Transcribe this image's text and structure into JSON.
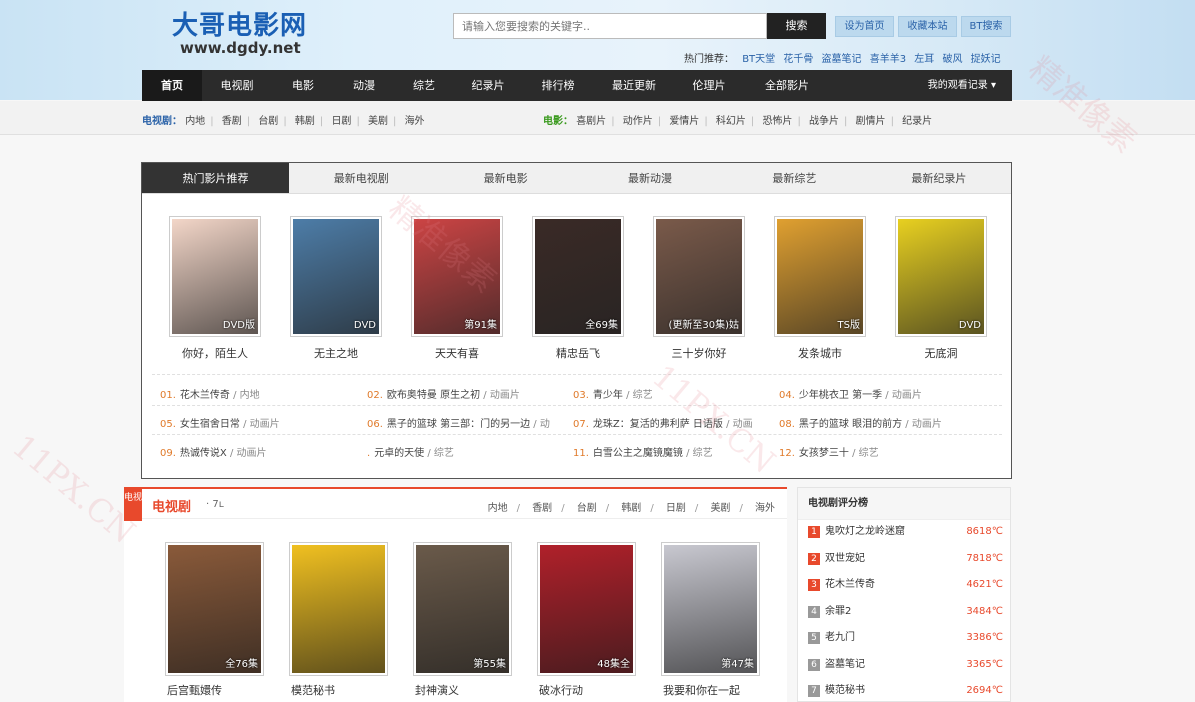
{
  "header": {
    "logo_cn": "大哥电影网",
    "logo_en": "www.dgdy.net",
    "search_placeholder": "请输入您要搜索的关键字..",
    "search_btn": "搜索",
    "top_links": [
      "设为首页",
      "收藏本站",
      "BT搜索"
    ],
    "hot_label": "热门推荐：",
    "hot_items": [
      "BT天堂",
      "花千骨",
      "盗墓笔记",
      "喜羊羊3",
      "左耳",
      "破风",
      "捉妖记"
    ]
  },
  "nav": {
    "items": [
      "首页",
      "电视剧",
      "电影",
      "动漫",
      "综艺",
      "纪录片",
      "排行榜",
      "最近更新",
      "伦理片",
      "全部影片"
    ],
    "record": "我的观看记录 ▾"
  },
  "subnav": {
    "tv_label": "电视剧：",
    "tv_items": [
      "内地",
      "香剧",
      "台剧",
      "韩剧",
      "日剧",
      "美剧",
      "海外"
    ],
    "movie_label": "电影：",
    "movie_items": [
      "喜剧片",
      "动作片",
      "爱情片",
      "科幻片",
      "恐怖片",
      "战争片",
      "剧情片",
      "纪录片"
    ]
  },
  "hot": {
    "tabs": [
      "热门影片推荐",
      "最新电视剧",
      "最新电影",
      "最新动漫",
      "最新综艺",
      "最新纪录片"
    ],
    "movies": [
      {
        "name": "你好，陌生人",
        "badge": "DVD版",
        "color": "#f3d6c8"
      },
      {
        "name": "无主之地",
        "badge": "DVD",
        "color": "#4d7da8"
      },
      {
        "name": "天天有喜",
        "badge": "第91集",
        "color": "#c44"
      },
      {
        "name": "精忠岳飞",
        "badge": "全69集",
        "color": "#3a2a26"
      },
      {
        "name": "三十岁你好",
        "badge": "(更新至30集)姑",
        "color": "#7a5a4a"
      },
      {
        "name": "发条城市",
        "badge": "TS版",
        "color": "#e0a030"
      },
      {
        "name": "无底洞",
        "badge": "DVD",
        "color": "#e8d020"
      }
    ],
    "list": [
      {
        "n": "01.",
        "t": "花木兰传奇",
        "c": "内地"
      },
      {
        "n": "02.",
        "t": "欧布奥特曼 原生之初",
        "c": "动画片"
      },
      {
        "n": "03.",
        "t": "青少年",
        "c": "综艺"
      },
      {
        "n": "04.",
        "t": "少年桃衣卫 第一季",
        "c": "动画片"
      },
      {
        "n": "05.",
        "t": "女生宿舍日常",
        "c": "动画片"
      },
      {
        "n": "06.",
        "t": "黑子的篮球 第三部：门的另一边",
        "c": "动"
      },
      {
        "n": "07.",
        "t": "龙珠Z：复活的弗利萨 日语版",
        "c": "动画"
      },
      {
        "n": "08.",
        "t": "黑子的篮球 眼泪的前方",
        "c": "动画片"
      },
      {
        "n": "09.",
        "t": "热诚传说X",
        "c": "动画片"
      },
      {
        "n": ".",
        "t": "元卓的天使",
        "c": "综艺"
      },
      {
        "n": "11.",
        "t": "白雪公主之魔镜魔镜",
        "c": "综艺"
      },
      {
        "n": "12.",
        "t": "女孩梦三十",
        "c": "综艺"
      }
    ]
  },
  "tv_section": {
    "icon": "电视",
    "title": "电视剧",
    "sub": "· 7ʟ",
    "links": [
      "内地",
      "香剧",
      "台剧",
      "韩剧",
      "日剧",
      "美剧",
      "海外"
    ],
    "movies": [
      {
        "name": "后宫甄嬛传",
        "badge": "全76集",
        "color": "#8a5a3a"
      },
      {
        "name": "模范秘书",
        "badge": "",
        "color": "#f0c020"
      },
      {
        "name": "封神演义",
        "badge": "第55集",
        "color": "#6a5a4a"
      },
      {
        "name": "破冰行动",
        "badge": "48集全",
        "color": "#b0202a"
      },
      {
        "name": "我要和你在一起",
        "badge": "第47集",
        "color": "#c8c8d0"
      }
    ]
  },
  "ranking": {
    "title": "电视剧评分榜",
    "items": [
      {
        "rank": "1",
        "name": "鬼吹灯之龙岭迷窟",
        "heat": "8618℃"
      },
      {
        "rank": "2",
        "name": "双世宠妃",
        "heat": "7818℃"
      },
      {
        "rank": "3",
        "name": "花木兰传奇",
        "heat": "4621℃"
      },
      {
        "rank": "4",
        "name": "余罪2",
        "heat": "3484℃"
      },
      {
        "rank": "5",
        "name": "老九门",
        "heat": "3386℃"
      },
      {
        "rank": "6",
        "name": "盗墓笔记",
        "heat": "3365℃"
      },
      {
        "rank": "7",
        "name": "模范秘书",
        "heat": "2694℃"
      }
    ]
  },
  "colors": {
    "accent": "#e8492c",
    "blue": "#2a62a8",
    "nav": "#2b2b2b"
  }
}
